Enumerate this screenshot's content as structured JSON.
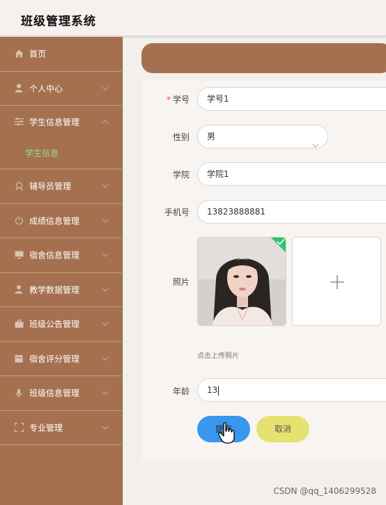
{
  "app": {
    "title": "班级管理系统"
  },
  "sidebar": {
    "items": [
      {
        "label": "首页",
        "icon": "home-icon",
        "has_chevron": false
      },
      {
        "label": "个人中心",
        "icon": "user-icon",
        "has_chevron": true
      },
      {
        "label": "学生信息管理",
        "icon": "sliders-icon",
        "has_chevron": true,
        "expanded": true,
        "children": [
          {
            "label": "学生信息"
          }
        ]
      },
      {
        "label": "辅导员管理",
        "icon": "badge-icon",
        "has_chevron": true
      },
      {
        "label": "成绩信息管理",
        "icon": "power-icon",
        "has_chevron": true
      },
      {
        "label": "宿舍信息管理",
        "icon": "monitor-icon",
        "has_chevron": true
      },
      {
        "label": "教学数据管理",
        "icon": "user-icon",
        "has_chevron": true
      },
      {
        "label": "班级公告管理",
        "icon": "briefcase-icon",
        "has_chevron": true
      },
      {
        "label": "宿舍评分管理",
        "icon": "calendar-icon",
        "has_chevron": true
      },
      {
        "label": "班级信息管理",
        "icon": "microphone-icon",
        "has_chevron": true
      },
      {
        "label": "专业管理",
        "icon": "fullscreen-icon",
        "has_chevron": true
      }
    ]
  },
  "form": {
    "student_no": {
      "label": "学号",
      "required_mark": "*",
      "value": "学号1"
    },
    "gender": {
      "label": "性别",
      "value": "男"
    },
    "college": {
      "label": "学院",
      "value": "学院1"
    },
    "phone": {
      "label": "手机号",
      "value": "13823888881"
    },
    "photo": {
      "label": "照片",
      "hint": "点击上传照片"
    },
    "age": {
      "label": "年龄",
      "value": "13"
    },
    "submit_label": "提交",
    "cancel_label": "取消"
  },
  "colors": {
    "sidebar": "#a5704f",
    "submenu_active": "#8ee08a",
    "submit": "#3a97f0",
    "cancel": "#e6e272",
    "required": "#e84c4c",
    "upload_success": "#2fc46b"
  },
  "watermark": "CSDN @qq_1406299528"
}
